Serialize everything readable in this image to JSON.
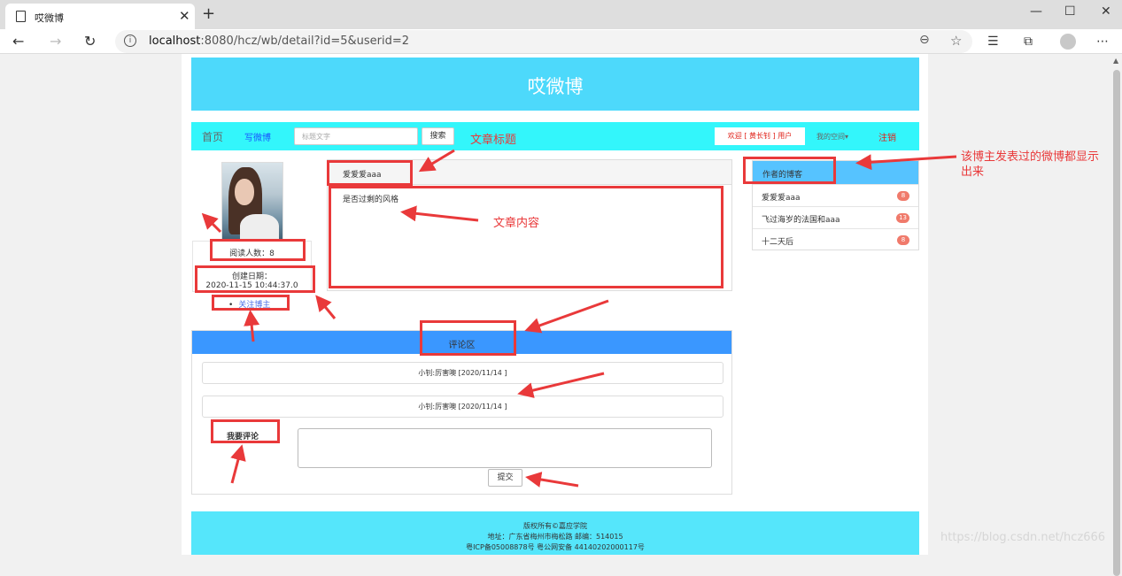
{
  "browser": {
    "tab_title": "哎微博",
    "tab_close": "✕",
    "new_tab": "+",
    "url_host": "localhost",
    "url_rest": ":8080/hcz/wb/detail?id=5&userid=2",
    "window_buttons": [
      "—",
      "☐",
      "✕"
    ]
  },
  "site": {
    "title": "哎微博"
  },
  "nav": {
    "home": "首页",
    "write": "写微博",
    "search_placeholder": "标题文字",
    "search_button": "搜索",
    "welcome": "欢迎 [ 黄长钊 ] 用户",
    "space": "我的空间▾",
    "logout": "注销"
  },
  "profile": {
    "read_count": "阅读人数：8",
    "create_label": "创建日期：",
    "create_date": "2020-11-15 10:44:37.0",
    "follow": "关注博主"
  },
  "article": {
    "title": "爱爱爱aaa",
    "content": "是否过剩的风格"
  },
  "author_posts": {
    "title": "作者的博客",
    "items": [
      {
        "title": "爱爱爱aaa",
        "count": "8"
      },
      {
        "title": "飞过海岁的法国和aaa",
        "count": "13"
      },
      {
        "title": "十二天后",
        "count": "8"
      }
    ]
  },
  "comments": {
    "title": "评论区",
    "items": [
      "小钊:厉害噢 [2020/11/14 ]",
      "小钊:厉害噢 [2020/11/14 ]"
    ],
    "my_comment_label": "我要评论",
    "submit": "提交"
  },
  "footer": {
    "line1": "版权所有©嘉应学院",
    "line2": "地址：广东省梅州市梅松路   邮编：514015",
    "line3": "粤ICP备05008878号      粤公网安备 44140202000117号"
  },
  "annotations": {
    "article_title_note": "文章标题",
    "article_content_note": "文章内容",
    "author_posts_note_line1": "该博主发表过的微博都显示",
    "author_posts_note_line2": "出来"
  },
  "watermark": "https://blog.csdn.net/hcz666",
  "colors": {
    "banner": "#4dd9fb",
    "navbar": "#33f6fb",
    "annotation_red": "#e9393a",
    "comment_header": "#3a97ff",
    "author_header": "#56c3ff",
    "footer": "#55e6fb"
  }
}
